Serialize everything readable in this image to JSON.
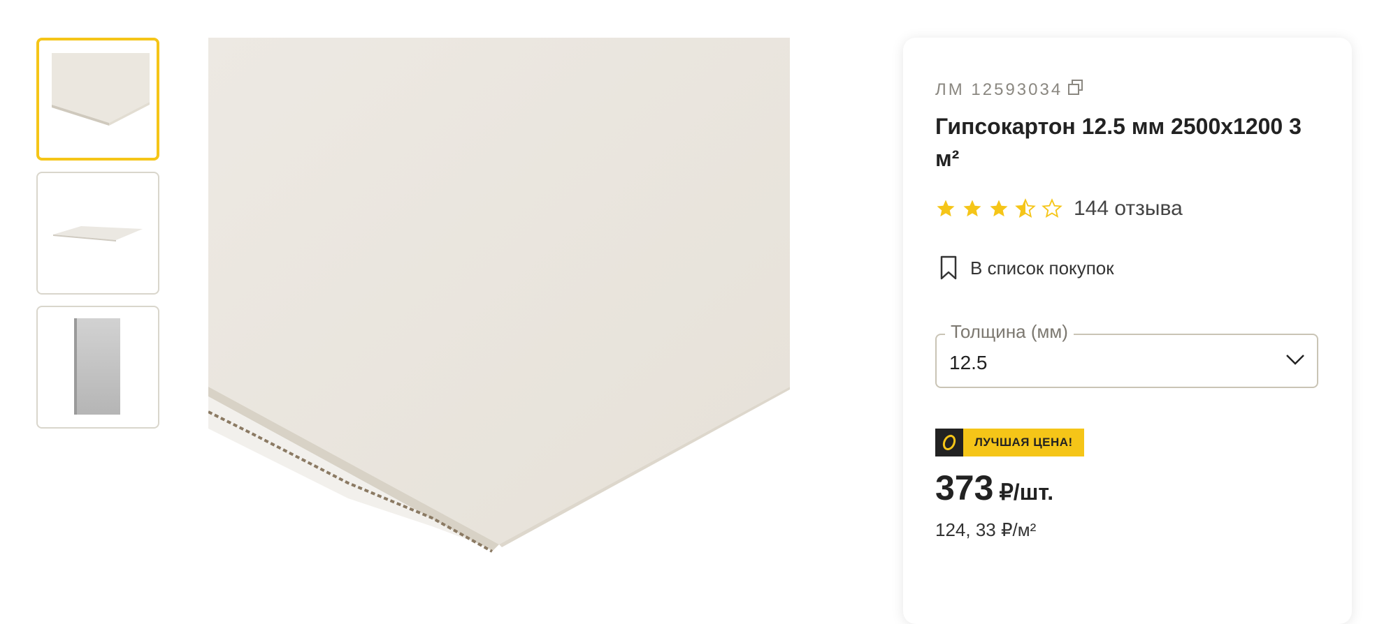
{
  "gallery": {
    "thumbnails": [
      {
        "icon": "drywall-angle-thumbnail",
        "active": true
      },
      {
        "icon": "drywall-flat-thumbnail",
        "active": false
      },
      {
        "icon": "drywall-side-thumbnail",
        "active": false
      }
    ],
    "main_image_icon": "drywall-sheet-closeup"
  },
  "product": {
    "sku": "ЛМ 12593034",
    "title": "Гипсокартон 12.5 мм 2500x1200 3 м²",
    "rating": 3.5,
    "reviews": "144 отзыва",
    "wishlist_label": "В список покупок",
    "thickness": {
      "label": "Толщина (мм)",
      "value": "12.5"
    },
    "badge": "ЛУЧШАЯ ЦЕНА!",
    "price": "373",
    "price_unit": "₽/шт.",
    "unit_price": "124, 33 ₽/м²"
  },
  "colors": {
    "accent": "#f5c518",
    "dark": "#222222",
    "star": "#f5c518"
  }
}
